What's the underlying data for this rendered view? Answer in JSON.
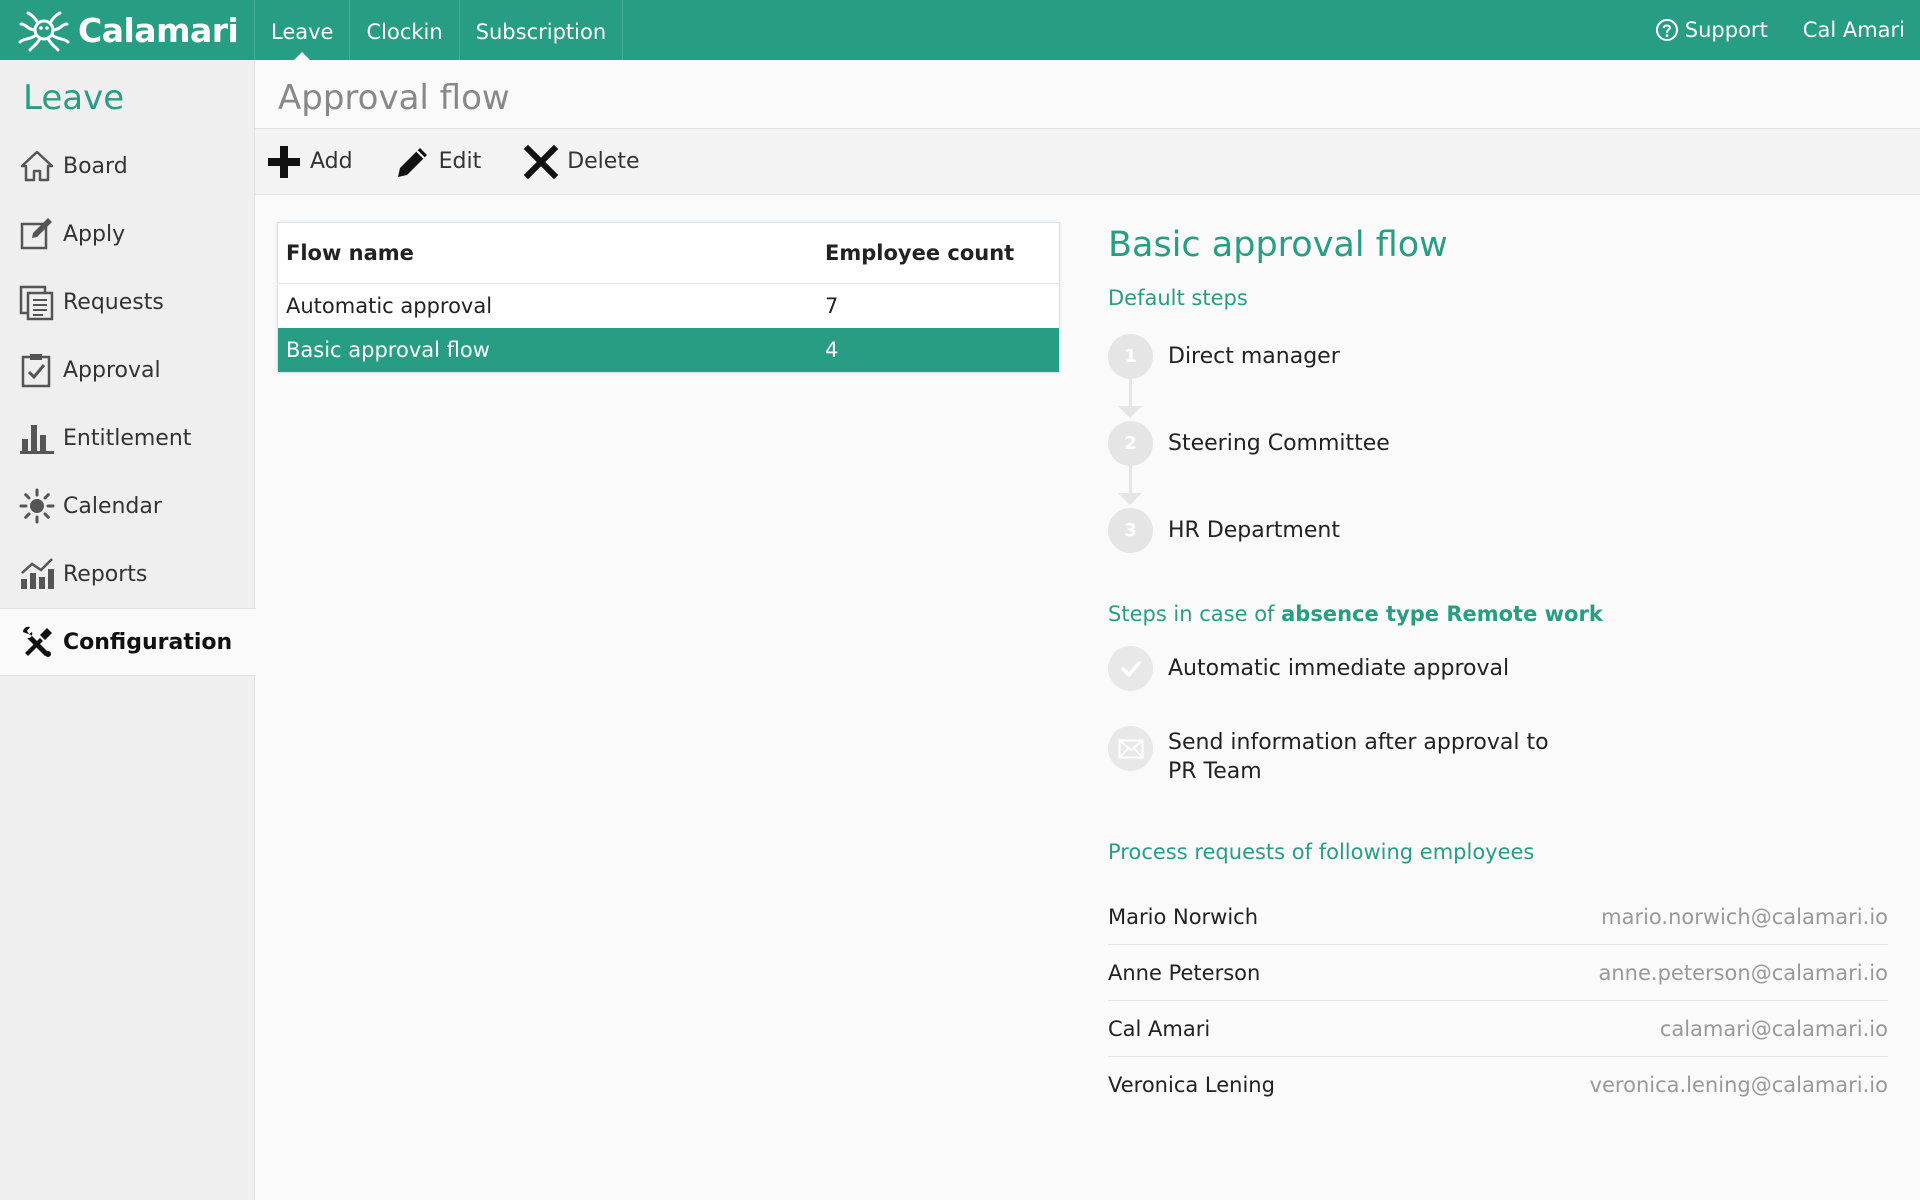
{
  "app": {
    "brand": "Calamari",
    "accent": "#279e84"
  },
  "topnav": {
    "items": [
      {
        "label": "Leave",
        "active": true
      },
      {
        "label": "Clockin",
        "active": false
      },
      {
        "label": "Subscription",
        "active": false
      }
    ],
    "support_label": "Support",
    "user_name": "Cal Amari"
  },
  "sidebar": {
    "title": "Leave",
    "items": [
      {
        "label": "Board",
        "icon": "home-icon"
      },
      {
        "label": "Apply",
        "icon": "edit-icon"
      },
      {
        "label": "Requests",
        "icon": "requests-icon"
      },
      {
        "label": "Approval",
        "icon": "clipboard-check-icon"
      },
      {
        "label": "Entitlement",
        "icon": "bar-chart-icon"
      },
      {
        "label": "Calendar",
        "icon": "sun-icon"
      },
      {
        "label": "Reports",
        "icon": "reports-chart-icon"
      },
      {
        "label": "Configuration",
        "icon": "tools-icon",
        "active": true
      }
    ]
  },
  "page": {
    "title": "Approval flow"
  },
  "toolbar": {
    "add_label": "Add",
    "edit_label": "Edit",
    "delete_label": "Delete"
  },
  "flows": {
    "headers": {
      "name": "Flow name",
      "count": "Employee count"
    },
    "rows": [
      {
        "name": "Automatic approval",
        "count": "7",
        "selected": false
      },
      {
        "name": "Basic approval flow",
        "count": "4",
        "selected": true
      }
    ]
  },
  "detail": {
    "title": "Basic approval flow",
    "default_steps_label": "Default steps",
    "steps": [
      {
        "num": "1",
        "label": "Direct manager"
      },
      {
        "num": "2",
        "label": "Steering Committee"
      },
      {
        "num": "3",
        "label": "HR Department"
      }
    ],
    "absence_label_prefix": "Steps in case of ",
    "absence_label_bold": "absence type Remote work",
    "absence_steps": [
      {
        "icon": "check-icon",
        "label": "Automatic immediate approval"
      },
      {
        "icon": "envelope-icon",
        "label_line1": "Send information after approval to",
        "label_line2": "PR Team"
      }
    ],
    "employees_label": "Process requests of following employees",
    "employees": [
      {
        "name": "Mario Norwich",
        "email": "mario.norwich@calamari.io"
      },
      {
        "name": "Anne Peterson",
        "email": "anne.peterson@calamari.io"
      },
      {
        "name": "Cal Amari",
        "email": "calamari@calamari.io"
      },
      {
        "name": "Veronica Lening",
        "email": "veronica.lening@calamari.io"
      }
    ]
  }
}
